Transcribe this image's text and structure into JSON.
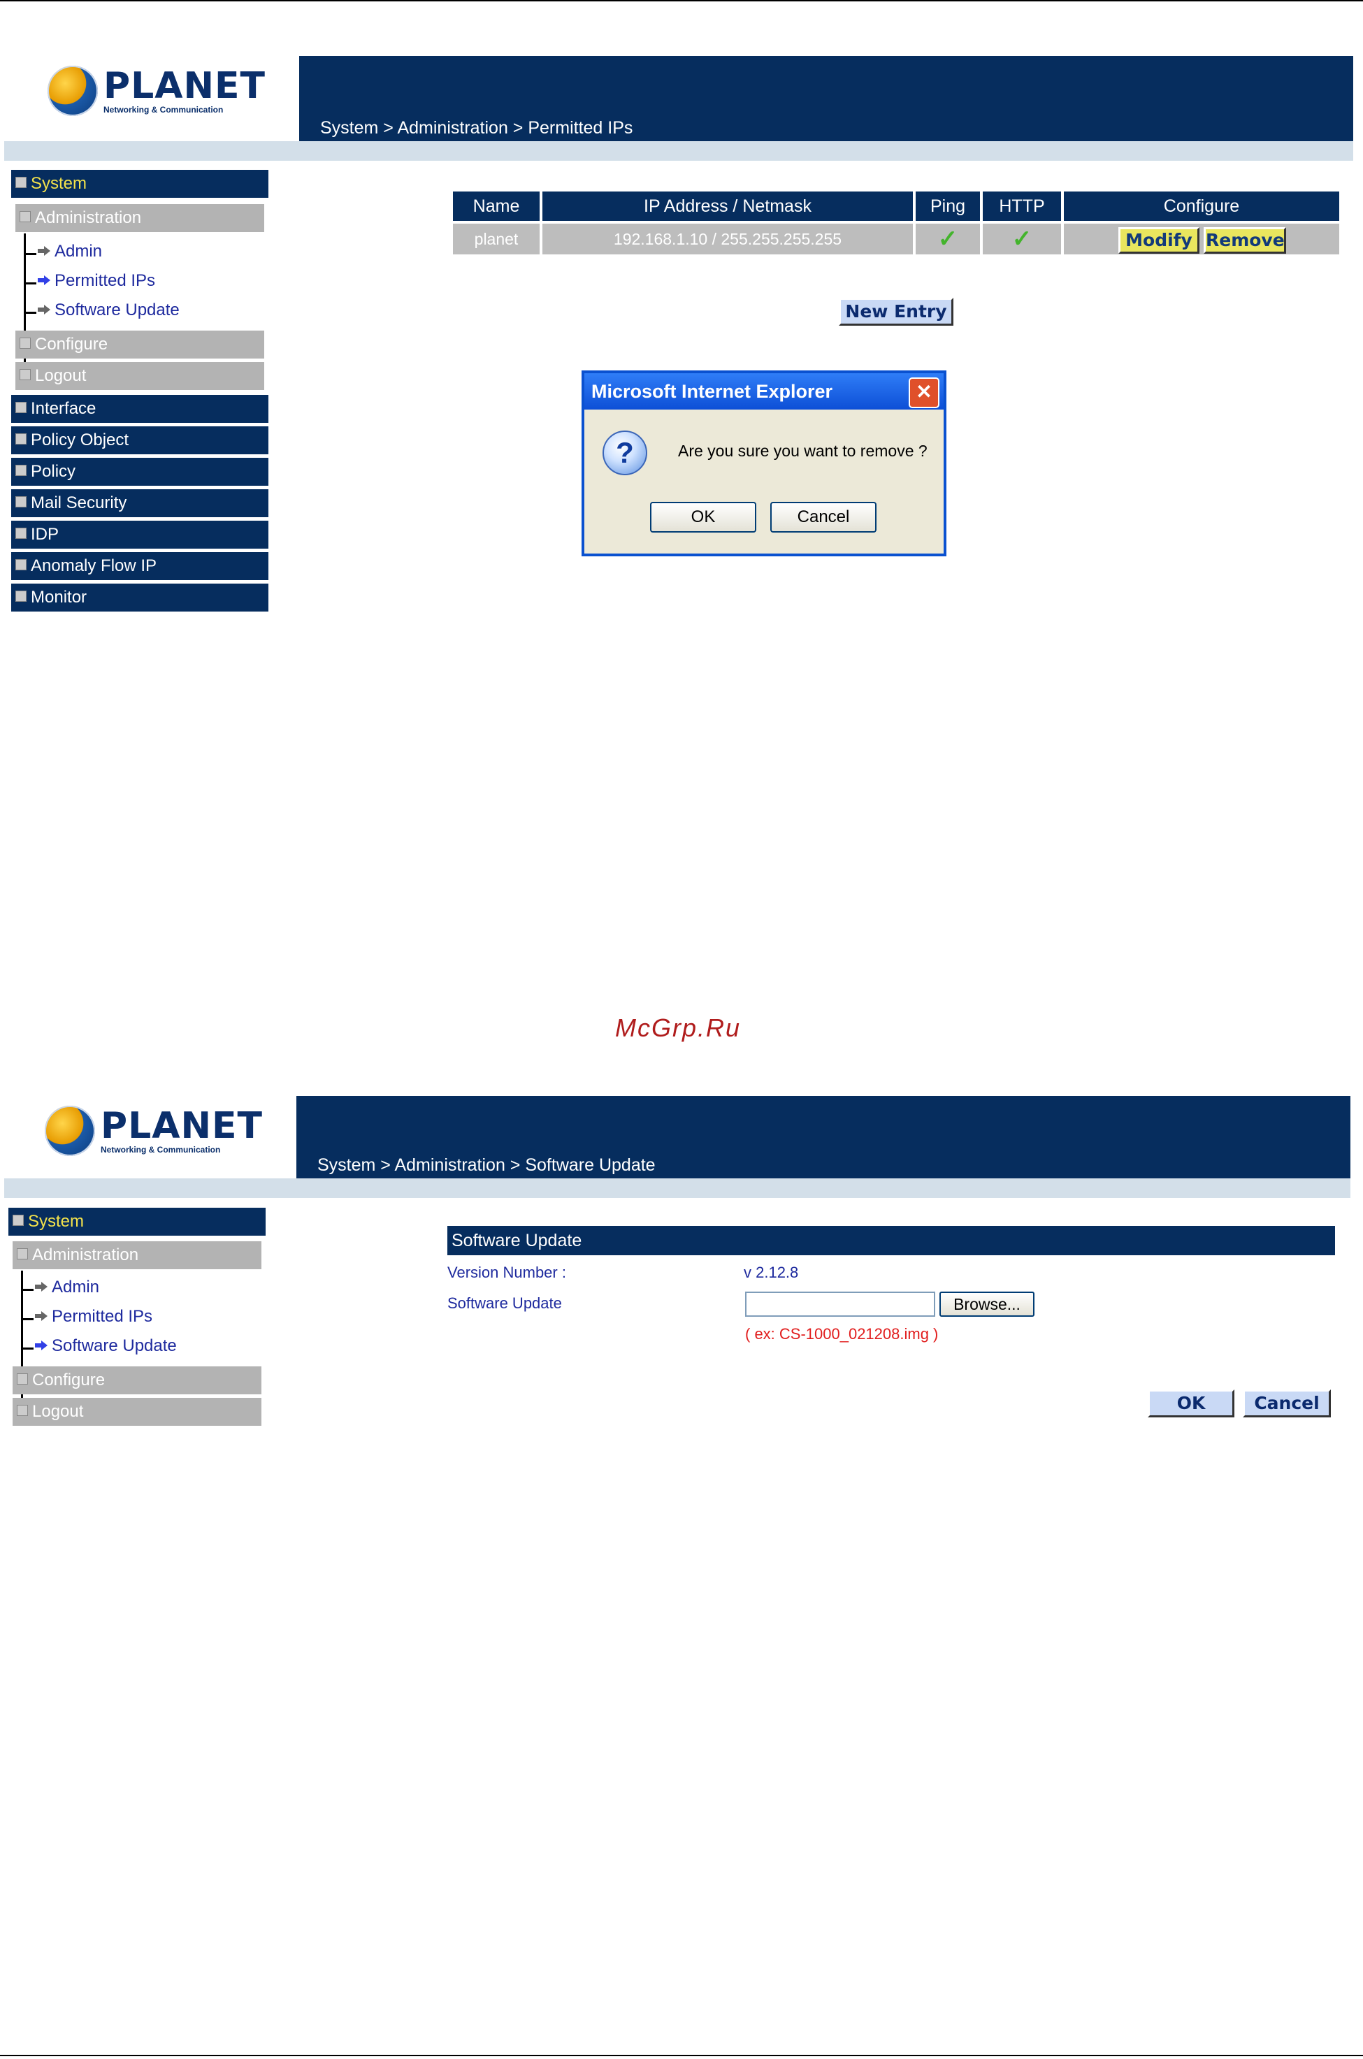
{
  "brand": {
    "name": "PLANET",
    "tagline": "Networking & Communication"
  },
  "screen1": {
    "breadcrumb": "System > Administration > Permitted IPs",
    "menu": {
      "system": "System",
      "administration": "Administration",
      "sub_items": [
        "Admin",
        "Permitted IPs",
        "Software Update"
      ],
      "configure": "Configure",
      "logout": "Logout",
      "sections": [
        "Interface",
        "Policy Object",
        "Policy",
        "Mail Security",
        "IDP",
        "Anomaly Flow IP",
        "Monitor"
      ]
    },
    "table": {
      "headers": [
        "Name",
        "IP Address / Netmask",
        "Ping",
        "HTTP",
        "Configure"
      ],
      "rows": [
        {
          "name": "planet",
          "ip": "192.168.1.10 / 255.255.255.255",
          "ping": "✓",
          "http": "✓",
          "modify": "Modify",
          "remove": "Remove"
        }
      ]
    },
    "new_entry": "New Entry",
    "dialog": {
      "title": "Microsoft Internet Explorer",
      "close": "✕",
      "icon": "?",
      "message": "Are you sure you want to remove ?",
      "ok": "OK",
      "cancel": "Cancel"
    }
  },
  "watermark": "McGrp.Ru",
  "screen2": {
    "breadcrumb": "System > Administration > Software Update",
    "menu": {
      "system": "System",
      "administration": "Administration",
      "sub_items": [
        "Admin",
        "Permitted IPs",
        "Software Update"
      ],
      "configure": "Configure",
      "logout": "Logout"
    },
    "panel": {
      "title": "Software Update",
      "version_label": "Version Number :",
      "version_value": "v 2.12.8",
      "update_label": "Software Update",
      "browse": "Browse...",
      "example": "( ex: CS-1000_021208.img )",
      "ok": "OK",
      "cancel": "Cancel"
    }
  }
}
